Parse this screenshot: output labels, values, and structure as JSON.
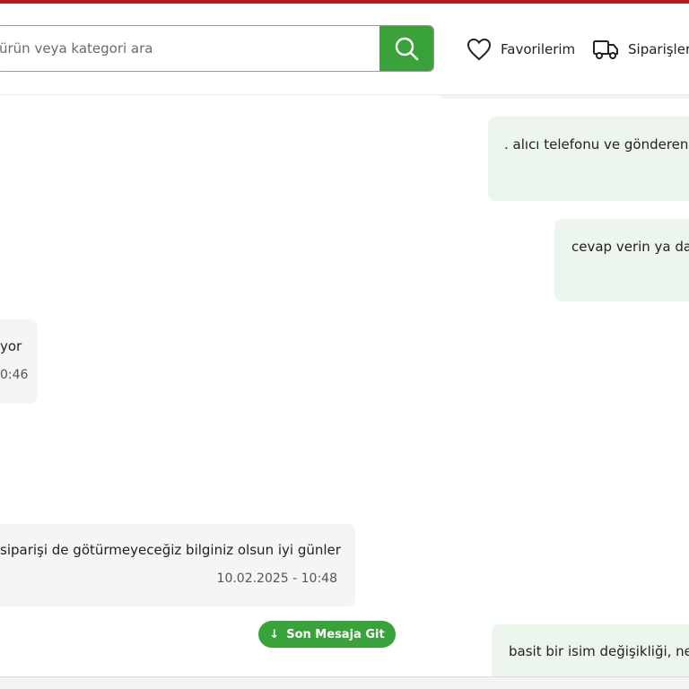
{
  "header": {
    "search": {
      "placeholder": "ürün veya kategori ara"
    },
    "nav": {
      "favorites_label": "Favorilerim",
      "orders_label": "Siparişler"
    }
  },
  "chat": {
    "messages": [
      {
        "direction": "out",
        "text": ". alıcı telefonu ve gönderen"
      },
      {
        "direction": "out",
        "text": "cevap verin ya da"
      },
      {
        "direction": "in",
        "text": "yor",
        "time": "0:46"
      },
      {
        "direction": "in",
        "text": "siparişi de götürmeyeceğiz bilginiz olsun iyi günler",
        "time": "10.02.2025 - 10:48"
      },
      {
        "direction": "out",
        "text": "basit bir isim değişikliği, ne"
      }
    ],
    "jump_button_label": "Son Mesaja Git"
  },
  "colors": {
    "brand_red": "#b01e22",
    "accent_green": "#3aa23a",
    "outgoing_bubble": "#edf6ec",
    "incoming_bubble": "#f5f5f5"
  }
}
